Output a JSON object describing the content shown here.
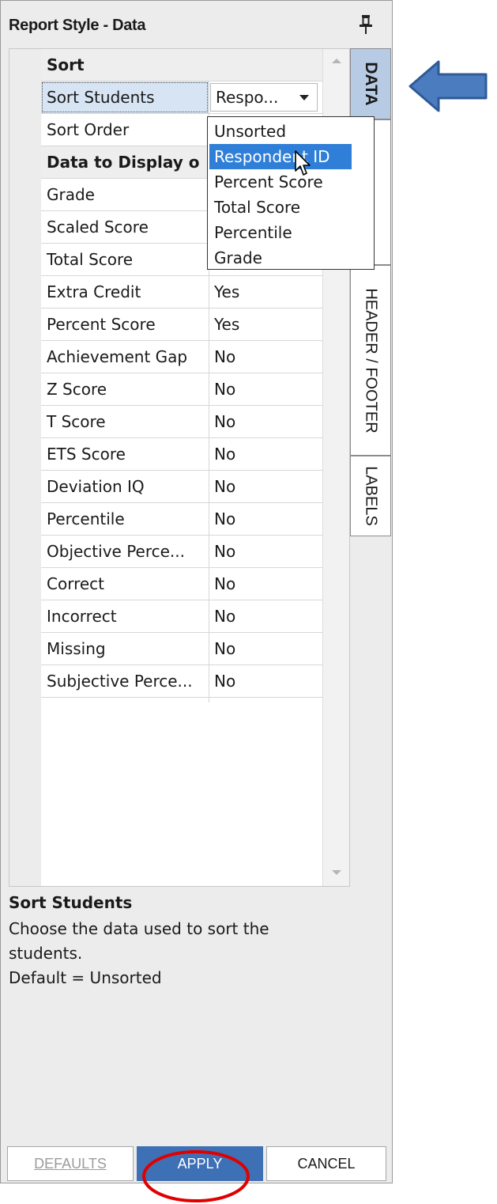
{
  "window": {
    "title": "Report Style - Data",
    "pin_icon": "pin-icon"
  },
  "grid": {
    "sort_category": "Sort",
    "sort_students": {
      "label": "Sort Students",
      "value": "Respo..."
    },
    "sort_order": {
      "label": "Sort Order"
    },
    "display_category": "Data to Display o",
    "rows": [
      {
        "label": "Grade",
        "value": ""
      },
      {
        "label": "Scaled Score",
        "value": ""
      },
      {
        "label": "Total Score",
        "value": ""
      },
      {
        "label": "Extra Credit",
        "value": "Yes"
      },
      {
        "label": "Percent Score",
        "value": "Yes"
      },
      {
        "label": "Achievement Gap",
        "value": "No"
      },
      {
        "label": "Z Score",
        "value": "No"
      },
      {
        "label": "T Score",
        "value": "No"
      },
      {
        "label": "ETS Score",
        "value": "No"
      },
      {
        "label": "Deviation IQ",
        "value": "No"
      },
      {
        "label": "Percentile",
        "value": "No"
      },
      {
        "label": "Objective Perce...",
        "value": "No"
      },
      {
        "label": "Correct",
        "value": "No"
      },
      {
        "label": "Incorrect",
        "value": "No"
      },
      {
        "label": "Missing",
        "value": "No"
      },
      {
        "label": "Subjective Perce...",
        "value": "No"
      }
    ]
  },
  "dropdown": {
    "options": [
      "Unsorted",
      "Respondent ID",
      "Percent Score",
      "Total Score",
      "Percentile",
      "Grade"
    ],
    "highlighted": "Respondent ID"
  },
  "tabs": [
    {
      "label": "DATA",
      "active": true
    },
    {
      "label": "HEADER / FOOTER",
      "active": false
    },
    {
      "label": "LABELS",
      "active": false
    }
  ],
  "help": {
    "title": "Sort Students",
    "lines": [
      "Choose the data used to sort the",
      "students.",
      "Default = Unsorted"
    ]
  },
  "buttons": {
    "defaults": "DEFAULTS",
    "apply": "APPLY",
    "cancel": "CANCEL"
  },
  "colors": {
    "accent": "#3e70b5",
    "annotation_arrow": "#4a7cbf",
    "annotation_circle": "#e00000",
    "highlight": "#2f7fd8"
  }
}
